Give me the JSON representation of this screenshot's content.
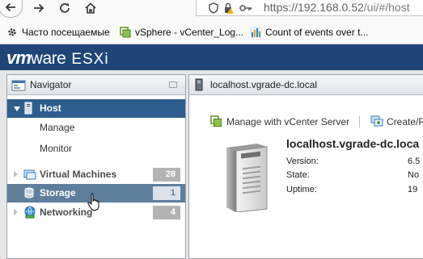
{
  "browser": {
    "url_host": "https://192.168.0.52",
    "url_path": "/ui/#/host",
    "bookmarks": [
      {
        "label": "Часто посещаемые",
        "icon": "gear-icon"
      },
      {
        "label": "vSphere - vCenter_Log...",
        "icon": "vsphere-icon"
      },
      {
        "label": "Count of events over t...",
        "icon": "chart-icon"
      }
    ]
  },
  "header": {
    "brand_vm": "vm",
    "brand_ware": "ware",
    "brand_product": "ESXi"
  },
  "navigator": {
    "title": "Navigator",
    "items": [
      {
        "label": "Host",
        "selected": true,
        "expanded": true,
        "icon": "server-icon"
      },
      {
        "label": "Manage"
      },
      {
        "label": "Monitor"
      },
      {
        "label": "Virtual Machines",
        "badge": "28",
        "icon": "vm-icon"
      },
      {
        "label": "Storage",
        "badge": "1",
        "icon": "storage-icon"
      },
      {
        "label": "Networking",
        "badge": "4",
        "icon": "network-icon"
      }
    ]
  },
  "main": {
    "title": "localhost.vgrade-dc.local",
    "actions": [
      {
        "label": "Manage with vCenter Server",
        "icon": "vcenter-icon"
      },
      {
        "label": "Create/R",
        "icon": "create-icon"
      }
    ],
    "host_name": "localhost.vgrade-dc.loca",
    "properties": [
      {
        "label": "Version:",
        "value": "6.5"
      },
      {
        "label": "State:",
        "value": "No"
      },
      {
        "label": "Uptime:",
        "value": "19"
      }
    ]
  },
  "colors": {
    "header_bg": "#1f4677",
    "selected_row": "#2d5e8e",
    "hover_row": "#5e7f9c",
    "badge": "#b3b3b3"
  }
}
